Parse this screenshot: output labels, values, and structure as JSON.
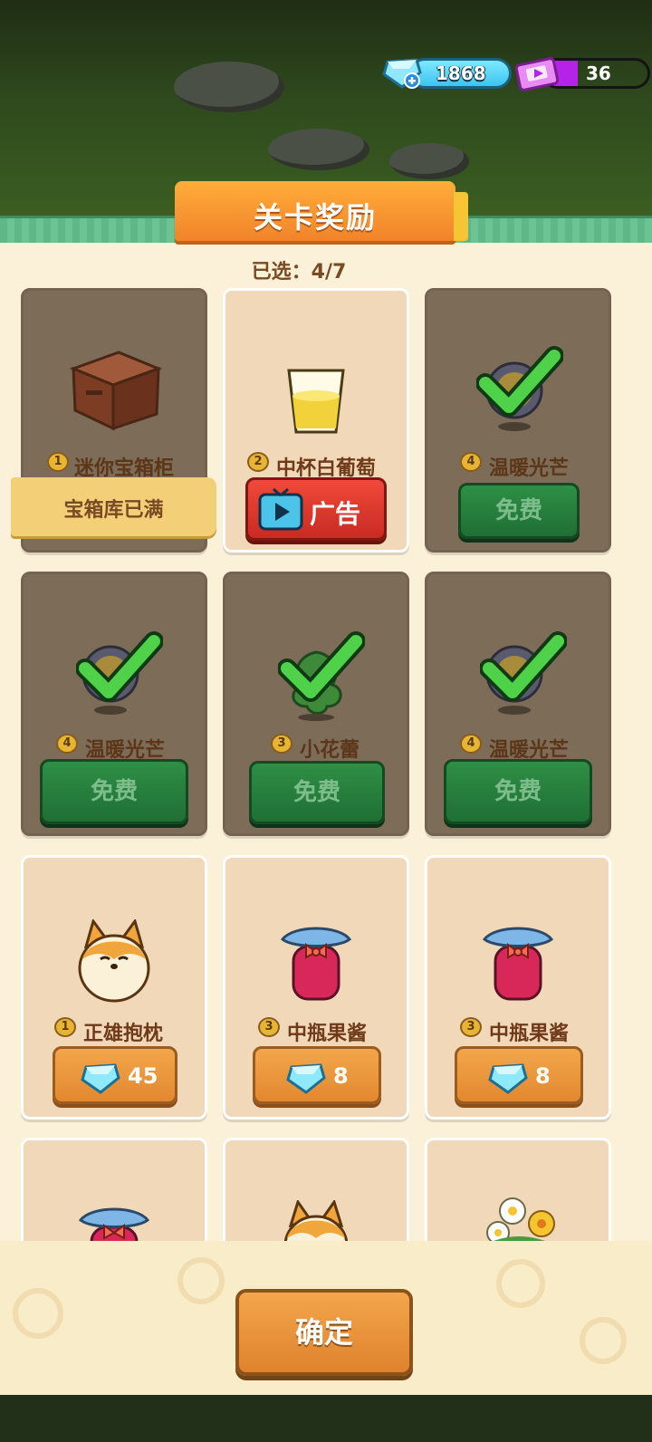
{
  "currency": {
    "gems": "1868",
    "tickets": "36"
  },
  "title": "关卡奖励",
  "selected": "已选：4/7",
  "full_banner": "宝箱库已满",
  "cards": [
    {
      "rarity": "1",
      "name": "迷你宝箱柜",
      "icon": "wooden-chest-icon",
      "claimed": true
    },
    {
      "rarity": "2",
      "name": "中杯白葡萄",
      "icon": "white-grape-cup-icon",
      "claimed": false,
      "button": "广告"
    },
    {
      "rarity": "4",
      "name": "温暖光芒",
      "icon": "warm-light-orb-icon",
      "claimed": true,
      "button": "免费"
    },
    {
      "rarity": "4",
      "name": "温暖光芒",
      "icon": "warm-light-orb-icon",
      "claimed": true,
      "button": "免费"
    },
    {
      "rarity": "3",
      "name": "小花蕾",
      "icon": "flower-bud-icon",
      "claimed": true,
      "button": "免费"
    },
    {
      "rarity": "4",
      "name": "温暖光芒",
      "icon": "warm-light-orb-icon",
      "claimed": true,
      "button": "免费"
    },
    {
      "rarity": "1",
      "name": "正雄抱枕",
      "icon": "shiba-pillow-icon",
      "claimed": false,
      "price": "45"
    },
    {
      "rarity": "3",
      "name": "中瓶果酱",
      "icon": "jam-jar-icon",
      "claimed": false,
      "price": "8"
    },
    {
      "rarity": "3",
      "name": "中瓶果酱",
      "icon": "jam-jar-icon",
      "claimed": false,
      "price": "8"
    }
  ],
  "confirm_label": "确定",
  "colors": {
    "panel": "#fbf1d9",
    "card_claimed": "#7d6c58",
    "card_open": "#f1d8b8",
    "green_button": "#2e8f45",
    "red_button": "#e33d30",
    "orange_button": "#e9952f",
    "title_tab": "#f5962f"
  }
}
